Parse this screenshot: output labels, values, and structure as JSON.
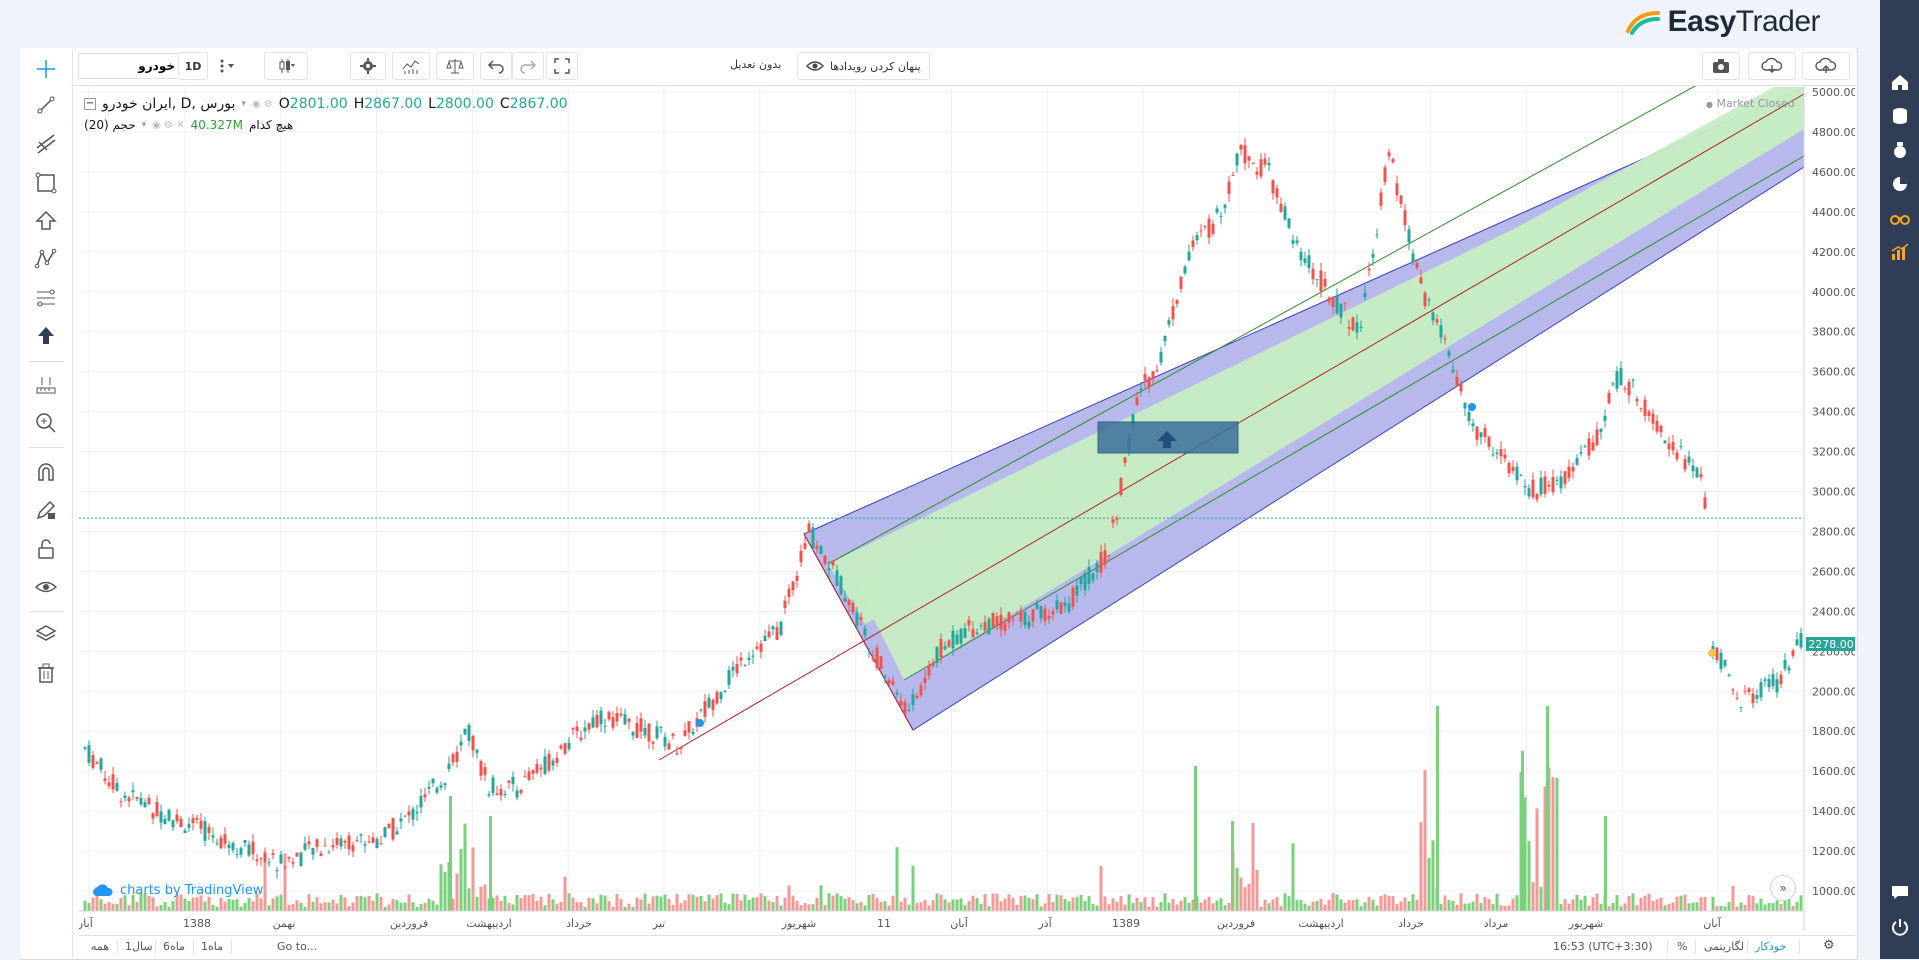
{
  "brand": {
    "name_bold": "Easy",
    "name_rest": "Trader"
  },
  "toolbar": {
    "symbol_value": "خودرو",
    "interval": "1D",
    "no_adjust_label": "بدون تعدیل",
    "hide_events_label": "پنهان کردن رویدادها"
  },
  "legend": {
    "title": "ایران خودرو, D, بورس",
    "open_label": "O",
    "open": "2801.00",
    "high_label": "H",
    "high": "2867.00",
    "low_label": "L",
    "low": "2800.00",
    "close_label": "C",
    "close": "2867.00",
    "volume_name": "حجم (20)",
    "volume_value": "40.327M",
    "volume_note": "هیچ کدام"
  },
  "market_status": "Market Closed",
  "tv_credit": "charts by TradingView",
  "bottom": {
    "ranges": [
      "همه",
      "1سال",
      "6ماه",
      "1ماه"
    ],
    "goto": "Go to...",
    "time": "16:53 (UTC+3:30)",
    "percent": "%",
    "log": "لگاریتمی",
    "auto": "خودکار"
  },
  "chart_data": {
    "type": "candlestick",
    "y_ticks": [
      1000,
      1200,
      1400,
      1600,
      1800,
      2000,
      2200,
      2400,
      2600,
      2800,
      3000,
      3200,
      3400,
      3600,
      3800,
      4000,
      4200,
      4400,
      4600,
      4800,
      5000
    ],
    "ylim": [
      900,
      5030
    ],
    "last_price": "2278.00",
    "price_line": 2867,
    "x_labels": [
      "آبان",
      "1388",
      "بهمن",
      "فروردین",
      "اردیبهشت",
      "خرداد",
      "تیر",
      "شهریور",
      "11",
      "آبان",
      "آذر",
      "1389",
      "فروردین",
      "اردیبهشت",
      "خرداد",
      "مرداد",
      "شهریور",
      "آبان"
    ],
    "colors": {
      "up": "#26a69a",
      "down": "#ef5350",
      "channel_outer": "#7b7fd6",
      "channel_inner": "#8fd68f",
      "median": "#b22222",
      "vol_up": "#7ccf7c",
      "vol_down": "#f29a9a"
    }
  }
}
